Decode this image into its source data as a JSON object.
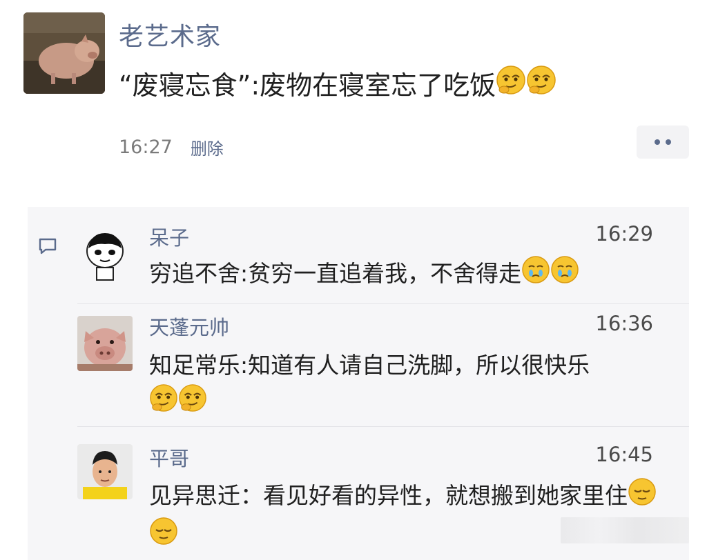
{
  "post": {
    "author": "老艺术家",
    "text": "“废寝忘食”:废物在寝室忘了吃饭",
    "emojis": [
      "smirk-emoji",
      "smirk-emoji"
    ],
    "time": "16:27",
    "delete_label": "删除"
  },
  "comments": [
    {
      "name": "呆子",
      "time": "16:29",
      "text": "穷追不舍:贫穷一直追着我，不舍得走",
      "emojis": [
        "cry-emoji",
        "cry-emoji"
      ],
      "avatar": "panda-meme-avatar"
    },
    {
      "name": "天蓬元帅",
      "time": "16:36",
      "text": "知足常乐:知道有人请自己洗脚，所以很快乐",
      "emojis": [
        "smirk-emoji",
        "smirk-emoji"
      ],
      "avatar": "pig-avatar"
    },
    {
      "name": "平哥",
      "time": "16:45",
      "text": "见异思迁：看见好看的异性，就想搬到她家里住",
      "emojis": [
        "sleepy-emoji",
        "sleepy-emoji"
      ],
      "avatar": "man-avatar"
    }
  ],
  "colors": {
    "name_blue": "#5b6b8c",
    "comment_bg": "#f6f6f8"
  }
}
